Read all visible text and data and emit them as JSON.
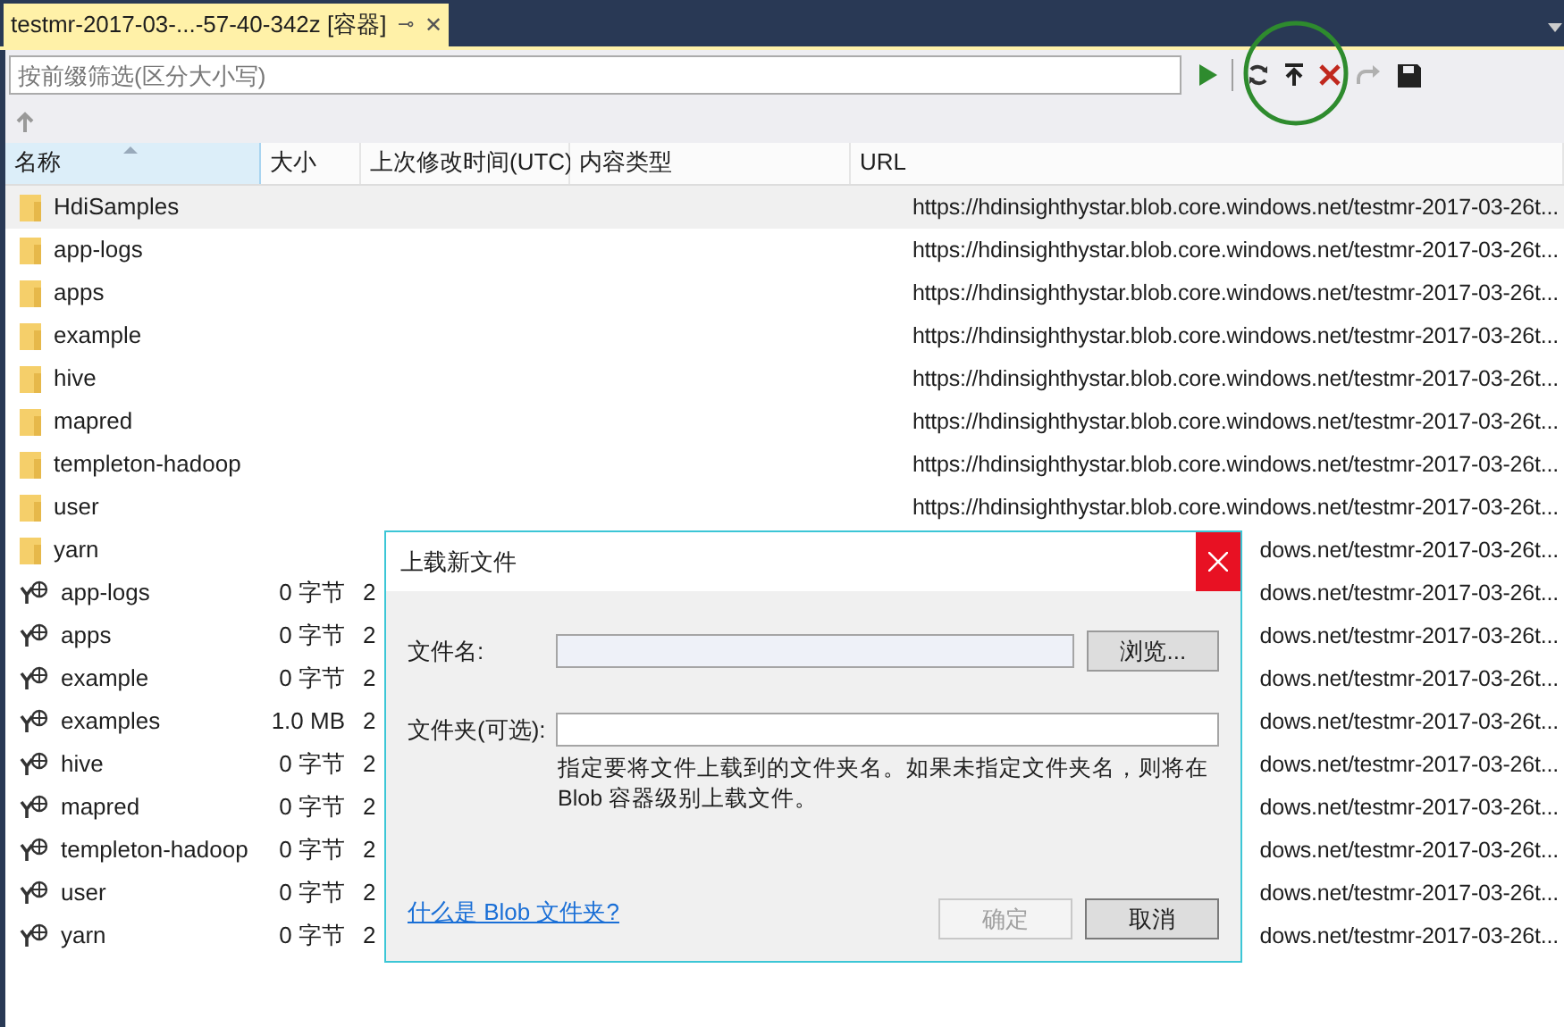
{
  "tab": {
    "title": "testmr-2017-03-...-57-40-342z [容器]",
    "pin": "⊸",
    "close": "✕"
  },
  "filter": {
    "placeholder": "按前缀筛选(区分大小写)"
  },
  "toolbar": [
    {
      "kind": "run",
      "disabled": false
    },
    {
      "kind": "separator",
      "disabled": false
    },
    {
      "kind": "refresh",
      "disabled": false
    },
    {
      "kind": "upload",
      "disabled": false
    },
    {
      "kind": "delete",
      "disabled": false
    },
    {
      "kind": "redo",
      "disabled": true
    },
    {
      "kind": "save",
      "disabled": false
    }
  ],
  "up_button": {
    "disabled": true
  },
  "columns": [
    {
      "label": "名称",
      "sorted": true
    },
    {
      "label": "大小",
      "sorted": false
    },
    {
      "label": "上次修改时间(UTC)",
      "sorted": false
    },
    {
      "label": "内容类型",
      "sorted": false
    },
    {
      "label": "URL",
      "sorted": false
    }
  ],
  "rows": [
    {
      "kind": "folder",
      "name": "HdiSamples",
      "url": "https://hdinsighthystar.blob.core.windows.net/testmr-2017-03-26t...",
      "selected": true
    },
    {
      "kind": "folder",
      "name": "app-logs",
      "url": "https://hdinsighthystar.blob.core.windows.net/testmr-2017-03-26t...",
      "selected": false
    },
    {
      "kind": "folder",
      "name": "apps",
      "url": "https://hdinsighthystar.blob.core.windows.net/testmr-2017-03-26t...",
      "selected": false
    },
    {
      "kind": "folder",
      "name": "example",
      "url": "https://hdinsighthystar.blob.core.windows.net/testmr-2017-03-26t...",
      "selected": false
    },
    {
      "kind": "folder",
      "name": "hive",
      "url": "https://hdinsighthystar.blob.core.windows.net/testmr-2017-03-26t...",
      "selected": false
    },
    {
      "kind": "folder",
      "name": "mapred",
      "url": "https://hdinsighthystar.blob.core.windows.net/testmr-2017-03-26t...",
      "selected": false
    },
    {
      "kind": "folder",
      "name": "templeton-hadoop",
      "url": "https://hdinsighthystar.blob.core.windows.net/testmr-2017-03-26t...",
      "selected": false
    },
    {
      "kind": "folder",
      "name": "user",
      "url": "https://hdinsighthystar.blob.core.windows.net/testmr-2017-03-26t...",
      "selected": false
    },
    {
      "kind": "folder",
      "name": "yarn",
      "url": "dows.net/testmr-2017-03-26t...",
      "selected": false
    },
    {
      "kind": "blob",
      "name": "app-logs",
      "size": "0 字节",
      "modified": "2",
      "url": "dows.net/testmr-2017-03-26t...",
      "selected": false
    },
    {
      "kind": "blob",
      "name": "apps",
      "size": "0 字节",
      "modified": "2",
      "url": "dows.net/testmr-2017-03-26t...",
      "selected": false
    },
    {
      "kind": "blob",
      "name": "example",
      "size": "0 字节",
      "modified": "2",
      "url": "dows.net/testmr-2017-03-26t...",
      "selected": false
    },
    {
      "kind": "blob",
      "name": "examples",
      "size": "1.0 MB",
      "modified": "2",
      "url": "dows.net/testmr-2017-03-26t...",
      "selected": false
    },
    {
      "kind": "blob",
      "name": "hive",
      "size": "0 字节",
      "modified": "2",
      "url": "dows.net/testmr-2017-03-26t...",
      "selected": false
    },
    {
      "kind": "blob",
      "name": "mapred",
      "size": "0 字节",
      "modified": "2",
      "url": "dows.net/testmr-2017-03-26t...",
      "selected": false
    },
    {
      "kind": "blob",
      "name": "templeton-hadoop",
      "size": "0 字节",
      "modified": "2",
      "url": "dows.net/testmr-2017-03-26t...",
      "selected": false
    },
    {
      "kind": "blob",
      "name": "user",
      "size": "0 字节",
      "modified": "2",
      "url": "dows.net/testmr-2017-03-26t...",
      "selected": false
    },
    {
      "kind": "blob",
      "name": "yarn",
      "size": "0 字节",
      "modified": "2",
      "url": "dows.net/testmr-2017-03-26t...",
      "selected": false
    }
  ],
  "dialog": {
    "title": "上载新文件",
    "fields": [
      {
        "label": "文件名:",
        "kind": "readonly",
        "button": "浏览..."
      },
      {
        "label": "文件夹(可选):",
        "kind": "text"
      }
    ],
    "hint": "指定要将文件上载到的文件夹名。如果未指定文件夹名，则将在 Blob 容器级别上载文件。",
    "link": "什么是 Blob 文件夹?",
    "buttons": [
      {
        "label": "确定",
        "disabled": true
      },
      {
        "label": "取消",
        "disabled": false
      }
    ]
  }
}
